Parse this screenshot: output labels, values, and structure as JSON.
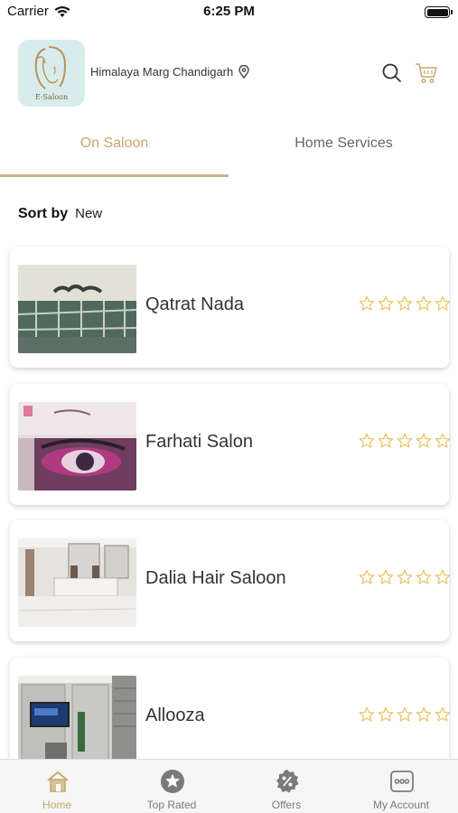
{
  "status_bar": {
    "carrier": "Carrier",
    "time": "6:25 PM"
  },
  "header": {
    "logo_text": "E-Saloon",
    "location": "Himalaya Marg Chandigarh"
  },
  "tabs": [
    {
      "label": "On Saloon",
      "active": true
    },
    {
      "label": "Home Services",
      "active": false
    }
  ],
  "sort": {
    "label": "Sort by",
    "value": "New"
  },
  "salons": [
    {
      "name": "Qatrat Nada",
      "rating": 0,
      "max_rating": 5
    },
    {
      "name": "Farhati Salon",
      "rating": 0,
      "max_rating": 5
    },
    {
      "name": "Dalia Hair Saloon",
      "rating": 0,
      "max_rating": 5
    },
    {
      "name": "Allooza",
      "rating": 0,
      "max_rating": 5
    }
  ],
  "tabbar": [
    {
      "label": "Home",
      "icon": "home-icon",
      "active": true
    },
    {
      "label": "Top Rated",
      "icon": "star-icon",
      "active": false
    },
    {
      "label": "Offers",
      "icon": "percent-icon",
      "active": false
    },
    {
      "label": "My Account",
      "icon": "more-icon",
      "active": false
    }
  ],
  "colors": {
    "accent": "#c4a870",
    "star": "#e8c15a",
    "tab_inactive": "#7a7a7a"
  }
}
